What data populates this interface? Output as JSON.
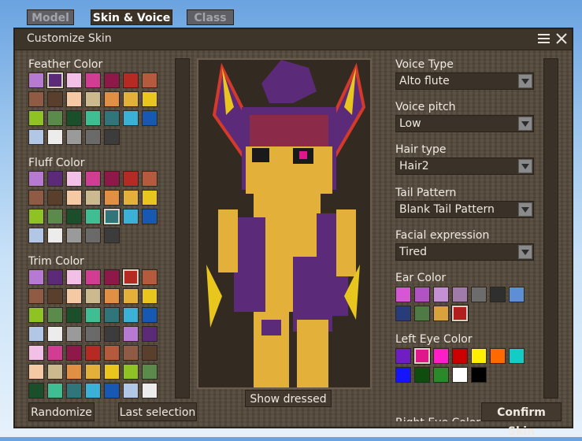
{
  "tabs": [
    {
      "label": "Model",
      "active": false
    },
    {
      "label": "Skin & Voice",
      "active": true
    },
    {
      "label": "Class",
      "active": false
    }
  ],
  "window": {
    "title": "Customize Skin"
  },
  "palettes": {
    "feather": {
      "title": "Feather Color",
      "selected": 1,
      "colors": [
        "#b77ad3",
        "#5b2a78",
        "#f2c0e6",
        "#d03d93",
        "#8e1948",
        "#b52a22",
        "#b55a3d",
        "#8f5b45",
        "#5a3f2c",
        "#f4c9a3",
        "#cdb98e",
        "#e08f43",
        "#e3b13a",
        "#e8c61d",
        "#8fc323",
        "#5b8b4b",
        "#1b4e2a",
        "#3fbd93",
        "#2f7579",
        "#3bb1d8",
        "#1758b2",
        "#b2c7e6",
        "#ececec",
        "#9a9a9a",
        "#6a6a6a",
        "#3c3c3c"
      ]
    },
    "fluff": {
      "title": "Fluff Color",
      "selected": 18,
      "colors": [
        "#b77ad3",
        "#5b2a78",
        "#f2c0e6",
        "#d03d93",
        "#8e1948",
        "#b52a22",
        "#b55a3d",
        "#8f5b45",
        "#5a3f2c",
        "#f4c9a3",
        "#cdb98e",
        "#e08f43",
        "#e3b13a",
        "#e8c61d",
        "#8fc323",
        "#5b8b4b",
        "#1b4e2a",
        "#3fbd93",
        "#2f7579",
        "#3bb1d8",
        "#1758b2",
        "#b2c7e6",
        "#ececec",
        "#9a9a9a",
        "#6a6a6a",
        "#3c3c3c"
      ]
    },
    "trim": {
      "title": "Trim Color",
      "selected": 5,
      "colors": [
        "#b77ad3",
        "#5b2a78",
        "#f2c0e6",
        "#d03d93",
        "#8e1948",
        "#b52a22",
        "#b55a3d",
        "#8f5b45",
        "#5a3f2c",
        "#f4c9a3",
        "#cdb98e",
        "#e08f43",
        "#e3b13a",
        "#e8c61d",
        "#8fc323",
        "#5b8b4b",
        "#1b4e2a",
        "#3fbd93",
        "#2f7579",
        "#3bb1d8",
        "#1758b2",
        "#b2c7e6",
        "#ececec",
        "#9a9a9a",
        "#6a6a6a",
        "#3c3c3c",
        "#b77ad3",
        "#5b2a78",
        "#f2c0e6",
        "#d03d93",
        "#8e1948",
        "#b52a22",
        "#b55a3d",
        "#8f5b45",
        "#5a3f2c",
        "#f4c9a3",
        "#cdb98e",
        "#e08f43",
        "#e3b13a",
        "#e8c61d",
        "#8fc323",
        "#5b8b4b",
        "#1b4e2a",
        "#3fbd93",
        "#2f7579",
        "#3bb1d8",
        "#1758b2",
        "#b2c7e6",
        "#ececec"
      ]
    },
    "ear": {
      "title": "Ear Color",
      "selected": 10,
      "colors": [
        "#d656d6",
        "#b352c4",
        "#c58fd3",
        "#a07aa8",
        "#6c6c6c",
        "#2f2f2f",
        "#5e8fd6",
        "#283b7a",
        "#4f7a45",
        "#d9a23a",
        "#b01e1e"
      ]
    },
    "left_eye": {
      "title": "Left Eye Color",
      "selected": 1,
      "colors": [
        "#6f1ec4",
        "#e0178a",
        "#ff1ec8",
        "#cc0000",
        "#ffee00",
        "#ff6a00",
        "#14ccc6",
        "#1414ff",
        "#0e4d0e",
        "#2a8a2a",
        "#ffffff",
        "#000000"
      ]
    }
  },
  "right_panel": {
    "voice_type": {
      "label": "Voice Type",
      "value": "Alto flute"
    },
    "voice_pitch": {
      "label": "Voice pitch",
      "value": "Low"
    },
    "hair_type": {
      "label": "Hair type",
      "value": "Hair2"
    },
    "tail_pattern": {
      "label": "Tail Pattern",
      "value": "Blank Tail Pattern"
    },
    "facial_expression": {
      "label": "Facial expression",
      "value": "Tired"
    },
    "clipped_label": "Right Eye Color"
  },
  "buttons": {
    "randomize": "Randomize",
    "last_selection": "Last selection",
    "show_dressed": "Show dressed",
    "confirm": "Confirm Skin"
  },
  "icons": {
    "menu": "hamburger-menu-icon",
    "close": "close-icon"
  }
}
